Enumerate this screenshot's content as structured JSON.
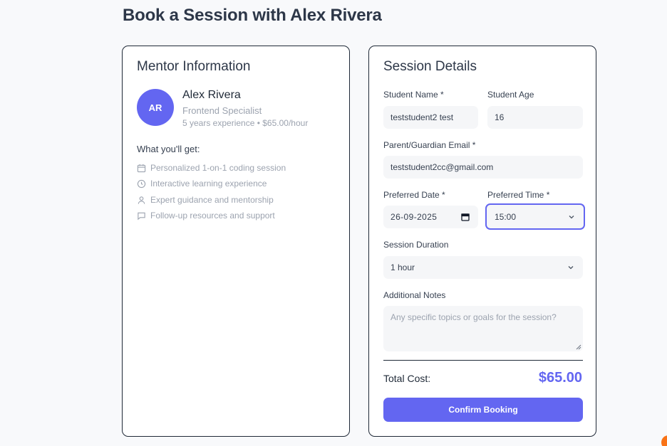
{
  "page": {
    "title": "Book a Session with Alex Rivera"
  },
  "mentor": {
    "section_title": "Mentor Information",
    "avatar_initials": "AR",
    "name": "Alex Rivera",
    "role": "Frontend Specialist",
    "meta": "5 years experience • $65.00/hour",
    "benefits_heading": "What you'll get:",
    "benefits": [
      {
        "icon": "calendar-icon",
        "label": "Personalized 1-on-1 coding session"
      },
      {
        "icon": "clock-icon",
        "label": "Interactive learning experience"
      },
      {
        "icon": "user-icon",
        "label": "Expert guidance and mentorship"
      },
      {
        "icon": "chat-icon",
        "label": "Follow-up resources and support"
      }
    ]
  },
  "session": {
    "section_title": "Session Details",
    "student_name": {
      "label": "Student Name *",
      "value": "teststudent2 test"
    },
    "student_age": {
      "label": "Student Age",
      "value": "16"
    },
    "guardian_email": {
      "label": "Parent/Guardian Email *",
      "value": "teststudent2cc@gmail.com"
    },
    "preferred_date": {
      "label": "Preferred Date *",
      "value": "26-09-2025"
    },
    "preferred_time": {
      "label": "Preferred Time *",
      "value": "15:00"
    },
    "duration": {
      "label": "Session Duration",
      "value": "1 hour"
    },
    "notes": {
      "label": "Additional Notes",
      "placeholder": "Any specific topics or goals for the session?"
    },
    "total_label": "Total Cost:",
    "total_value": "$65.00",
    "confirm_label": "Confirm Booking"
  },
  "colors": {
    "accent": "#6366f1",
    "muted_text": "#9ca3af",
    "corner_badge": "#f97316"
  }
}
